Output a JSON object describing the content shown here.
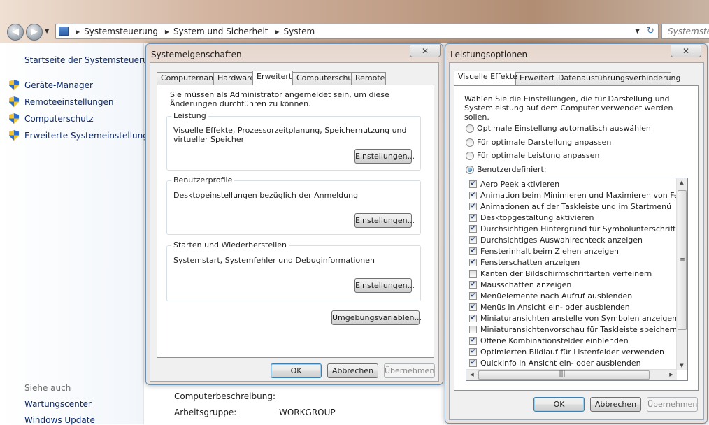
{
  "explorer": {
    "breadcrumbs": [
      "Systemsteuerung",
      "System und Sicherheit",
      "System"
    ],
    "search_placeholder": "Systemsteu"
  },
  "leftpane": {
    "home_link": "Startseite der Systemsteuerung",
    "links": [
      "Geräte-Manager",
      "Remoteeinstellungen",
      "Computerschutz",
      "Erweiterte Systemeinstellungen"
    ],
    "see_also_heading": "Siehe auch",
    "see_also": [
      "Wartungscenter",
      "Windows Update"
    ]
  },
  "main": {
    "computer_description_label": "Computerbeschreibung:",
    "workgroup_label": "Arbeitsgruppe:",
    "workgroup_value": "WORKGROUP"
  },
  "sysprops": {
    "title": "Systemeigenschaften",
    "tabs": [
      "Computername",
      "Hardware",
      "Erweitert",
      "Computerschutz",
      "Remote"
    ],
    "active_tab": "Erweitert",
    "admin_note": "Sie müssen als Administrator angemeldet sein, um diese Änderungen durchführen zu können.",
    "groups": [
      {
        "title": "Leistung",
        "text": "Visuelle Effekte, Prozessorzeitplanung, Speichernutzung und virtueller Speicher",
        "button": "Einstellungen..."
      },
      {
        "title": "Benutzerprofile",
        "text": "Desktopeinstellungen bezüglich der Anmeldung",
        "button": "Einstellungen..."
      },
      {
        "title": "Starten und Wiederherstellen",
        "text": "Systemstart, Systemfehler und Debuginformationen",
        "button": "Einstellungen..."
      }
    ],
    "env_button": "Umgebungsvariablen...",
    "ok": "OK",
    "cancel": "Abbrechen",
    "apply": "Übernehmen"
  },
  "perfopts": {
    "title": "Leistungsoptionen",
    "tabs": [
      "Visuelle Effekte",
      "Erweitert",
      "Datenausführungsverhinderung"
    ],
    "active_tab": "Visuelle Effekte",
    "intro": "Wählen Sie die Einstellungen, die für Darstellung und Systemleistung auf dem Computer verwendet werden sollen.",
    "radios": [
      {
        "label": "Optimale Einstellung automatisch auswählen",
        "selected": false
      },
      {
        "label": "Für optimale Darstellung anpassen",
        "selected": false
      },
      {
        "label": "Für optimale Leistung anpassen",
        "selected": false
      },
      {
        "label": "Benutzerdefiniert:",
        "selected": true
      }
    ],
    "effects": [
      {
        "label": "Aero Peek aktivieren",
        "checked": true
      },
      {
        "label": "Animation beim Minimieren und Maximieren von Fenstern",
        "checked": true
      },
      {
        "label": "Animationen auf der Taskleiste und im Startmenü",
        "checked": true
      },
      {
        "label": "Desktopgestaltung aktivieren",
        "checked": true
      },
      {
        "label": "Durchsichtigen Hintergrund für Symbolunterschriften auf d",
        "checked": true
      },
      {
        "label": "Durchsichtiges Auswahlrechteck anzeigen",
        "checked": true
      },
      {
        "label": "Fensterinhalt beim Ziehen anzeigen",
        "checked": true
      },
      {
        "label": "Fensterschatten anzeigen",
        "checked": true
      },
      {
        "label": "Kanten der Bildschirmschriftarten verfeinern",
        "checked": false
      },
      {
        "label": "Mausschatten anzeigen",
        "checked": true
      },
      {
        "label": "Menüelemente nach Aufruf ausblenden",
        "checked": true
      },
      {
        "label": "Menüs in Ansicht ein- oder ausblenden",
        "checked": true
      },
      {
        "label": "Miniaturansichten anstelle von Symbolen anzeigen",
        "checked": true
      },
      {
        "label": "Miniaturansichtenvorschau für Taskleiste speichern",
        "checked": false
      },
      {
        "label": "Offene Kombinationsfelder einblenden",
        "checked": true
      },
      {
        "label": "Optimierten Bildlauf für Listenfelder verwenden",
        "checked": true
      },
      {
        "label": "Quickinfo in Ansicht ein- oder ausblenden",
        "checked": true
      }
    ],
    "ok": "OK",
    "cancel": "Abbrechen",
    "apply": "Übernehmen"
  }
}
